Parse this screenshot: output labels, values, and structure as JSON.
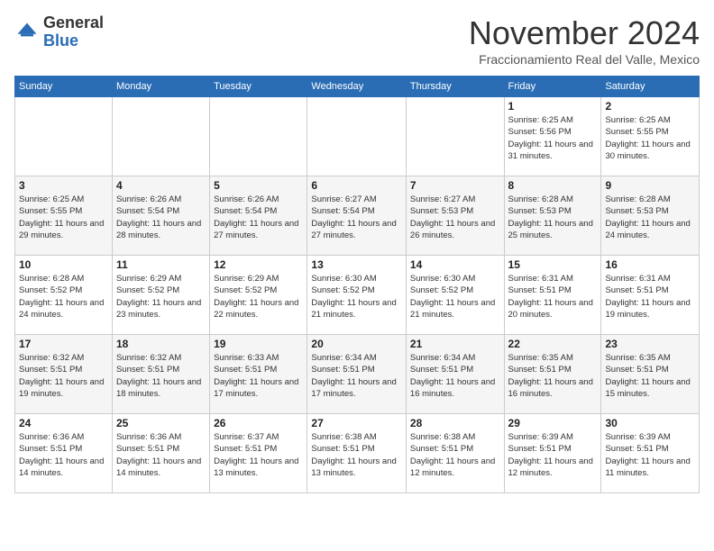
{
  "header": {
    "logo_general": "General",
    "logo_blue": "Blue",
    "month_title": "November 2024",
    "location": "Fraccionamiento Real del Valle, Mexico"
  },
  "days_of_week": [
    "Sunday",
    "Monday",
    "Tuesday",
    "Wednesday",
    "Thursday",
    "Friday",
    "Saturday"
  ],
  "weeks": [
    [
      {
        "day": "",
        "info": ""
      },
      {
        "day": "",
        "info": ""
      },
      {
        "day": "",
        "info": ""
      },
      {
        "day": "",
        "info": ""
      },
      {
        "day": "",
        "info": ""
      },
      {
        "day": "1",
        "info": "Sunrise: 6:25 AM\nSunset: 5:56 PM\nDaylight: 11 hours and 31 minutes."
      },
      {
        "day": "2",
        "info": "Sunrise: 6:25 AM\nSunset: 5:55 PM\nDaylight: 11 hours and 30 minutes."
      }
    ],
    [
      {
        "day": "3",
        "info": "Sunrise: 6:25 AM\nSunset: 5:55 PM\nDaylight: 11 hours and 29 minutes."
      },
      {
        "day": "4",
        "info": "Sunrise: 6:26 AM\nSunset: 5:54 PM\nDaylight: 11 hours and 28 minutes."
      },
      {
        "day": "5",
        "info": "Sunrise: 6:26 AM\nSunset: 5:54 PM\nDaylight: 11 hours and 27 minutes."
      },
      {
        "day": "6",
        "info": "Sunrise: 6:27 AM\nSunset: 5:54 PM\nDaylight: 11 hours and 27 minutes."
      },
      {
        "day": "7",
        "info": "Sunrise: 6:27 AM\nSunset: 5:53 PM\nDaylight: 11 hours and 26 minutes."
      },
      {
        "day": "8",
        "info": "Sunrise: 6:28 AM\nSunset: 5:53 PM\nDaylight: 11 hours and 25 minutes."
      },
      {
        "day": "9",
        "info": "Sunrise: 6:28 AM\nSunset: 5:53 PM\nDaylight: 11 hours and 24 minutes."
      }
    ],
    [
      {
        "day": "10",
        "info": "Sunrise: 6:28 AM\nSunset: 5:52 PM\nDaylight: 11 hours and 24 minutes."
      },
      {
        "day": "11",
        "info": "Sunrise: 6:29 AM\nSunset: 5:52 PM\nDaylight: 11 hours and 23 minutes."
      },
      {
        "day": "12",
        "info": "Sunrise: 6:29 AM\nSunset: 5:52 PM\nDaylight: 11 hours and 22 minutes."
      },
      {
        "day": "13",
        "info": "Sunrise: 6:30 AM\nSunset: 5:52 PM\nDaylight: 11 hours and 21 minutes."
      },
      {
        "day": "14",
        "info": "Sunrise: 6:30 AM\nSunset: 5:52 PM\nDaylight: 11 hours and 21 minutes."
      },
      {
        "day": "15",
        "info": "Sunrise: 6:31 AM\nSunset: 5:51 PM\nDaylight: 11 hours and 20 minutes."
      },
      {
        "day": "16",
        "info": "Sunrise: 6:31 AM\nSunset: 5:51 PM\nDaylight: 11 hours and 19 minutes."
      }
    ],
    [
      {
        "day": "17",
        "info": "Sunrise: 6:32 AM\nSunset: 5:51 PM\nDaylight: 11 hours and 19 minutes."
      },
      {
        "day": "18",
        "info": "Sunrise: 6:32 AM\nSunset: 5:51 PM\nDaylight: 11 hours and 18 minutes."
      },
      {
        "day": "19",
        "info": "Sunrise: 6:33 AM\nSunset: 5:51 PM\nDaylight: 11 hours and 17 minutes."
      },
      {
        "day": "20",
        "info": "Sunrise: 6:34 AM\nSunset: 5:51 PM\nDaylight: 11 hours and 17 minutes."
      },
      {
        "day": "21",
        "info": "Sunrise: 6:34 AM\nSunset: 5:51 PM\nDaylight: 11 hours and 16 minutes."
      },
      {
        "day": "22",
        "info": "Sunrise: 6:35 AM\nSunset: 5:51 PM\nDaylight: 11 hours and 16 minutes."
      },
      {
        "day": "23",
        "info": "Sunrise: 6:35 AM\nSunset: 5:51 PM\nDaylight: 11 hours and 15 minutes."
      }
    ],
    [
      {
        "day": "24",
        "info": "Sunrise: 6:36 AM\nSunset: 5:51 PM\nDaylight: 11 hours and 14 minutes."
      },
      {
        "day": "25",
        "info": "Sunrise: 6:36 AM\nSunset: 5:51 PM\nDaylight: 11 hours and 14 minutes."
      },
      {
        "day": "26",
        "info": "Sunrise: 6:37 AM\nSunset: 5:51 PM\nDaylight: 11 hours and 13 minutes."
      },
      {
        "day": "27",
        "info": "Sunrise: 6:38 AM\nSunset: 5:51 PM\nDaylight: 11 hours and 13 minutes."
      },
      {
        "day": "28",
        "info": "Sunrise: 6:38 AM\nSunset: 5:51 PM\nDaylight: 11 hours and 12 minutes."
      },
      {
        "day": "29",
        "info": "Sunrise: 6:39 AM\nSunset: 5:51 PM\nDaylight: 11 hours and 12 minutes."
      },
      {
        "day": "30",
        "info": "Sunrise: 6:39 AM\nSunset: 5:51 PM\nDaylight: 11 hours and 11 minutes."
      }
    ]
  ]
}
